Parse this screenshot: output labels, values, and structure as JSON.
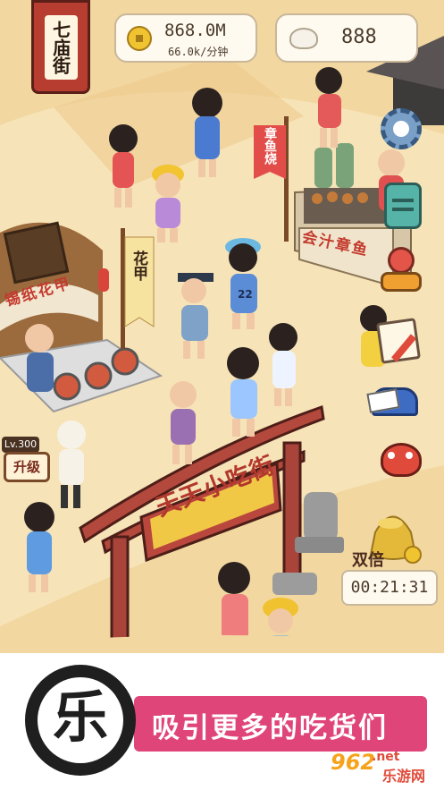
{
  "hud": {
    "street_sign": "七庙街",
    "coins": {
      "amount": "868.0M",
      "rate": "66.0k/分钟",
      "icon": "coin-icon"
    },
    "buns": {
      "amount": "888",
      "icon": "bun-icon"
    }
  },
  "gate": {
    "sign": "天天小吃街"
  },
  "stalls": {
    "left_stall_sign": "锡纸花甲",
    "left_flag": "花甲",
    "right_stall_sign": "会汁章鱼",
    "right_flag": "章鱼烧",
    "level": "Lv.300",
    "upgrade_button": "升级"
  },
  "player": {
    "shirt_number": "22"
  },
  "double_bonus": {
    "label": "双倍",
    "timer": "00:21:31"
  },
  "side_menu": [
    "gear-icon",
    "clipboard-icon",
    "delivery-rider-icon",
    "notepad-icon",
    "mailbox-icon",
    "lion-dance-icon"
  ],
  "promo": {
    "logo_char": "乐",
    "caption": "吸引更多的吃货们"
  },
  "watermark": {
    "number": "962",
    "suffix": ".net",
    "site": "乐游网"
  },
  "colors": {
    "promo_banner": "#e0457a",
    "gate": "#a9443b",
    "ground": "#f3d9a4"
  }
}
